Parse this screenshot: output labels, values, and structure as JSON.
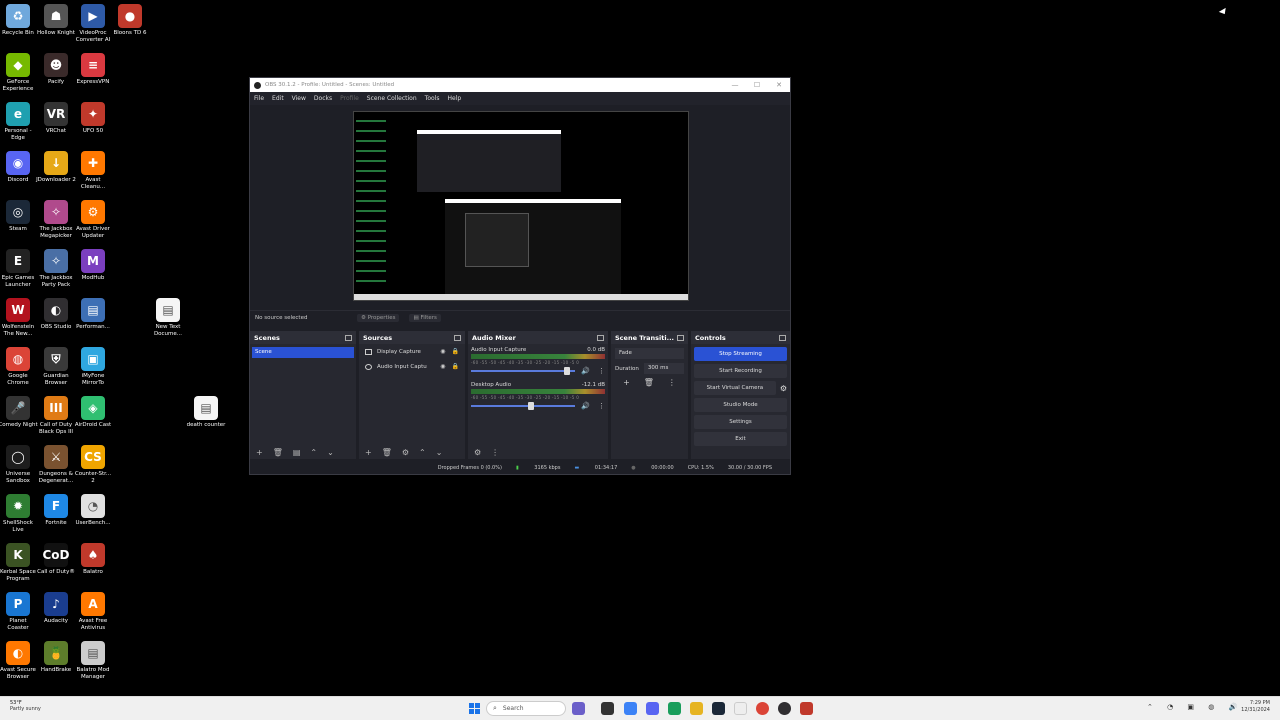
{
  "desktop": {
    "icons": [
      {
        "label": "Recycle Bin",
        "color": "#6fa8dc",
        "glyph": "♻"
      },
      {
        "label": "Hollow Knight",
        "color": "#555555",
        "glyph": "☗"
      },
      {
        "label": "VideoProc Converter AI",
        "color": "#2e5aa7",
        "glyph": "▶"
      },
      {
        "label": "Bloons TD 6",
        "color": "#c0392b",
        "glyph": "●"
      },
      {
        "label": "GeForce Experience",
        "color": "#76b900",
        "glyph": "◆"
      },
      {
        "label": "Pacify",
        "color": "#3a2a2a",
        "glyph": "☻"
      },
      {
        "label": "ExpressVPN",
        "color": "#da3940",
        "glyph": "≡"
      },
      {
        "label": "Personal - Edge",
        "color": "#1fa0b0",
        "glyph": "e"
      },
      {
        "label": "VRChat",
        "color": "#333333",
        "glyph": "VR"
      },
      {
        "label": "UFO 50",
        "color": "#c0392b",
        "glyph": "✦"
      },
      {
        "label": "Discord",
        "color": "#5865f2",
        "glyph": "◉"
      },
      {
        "label": "JDownloader 2",
        "color": "#e6a817",
        "glyph": "↓"
      },
      {
        "label": "Avast Cleanu...",
        "color": "#ff7800",
        "glyph": "✚"
      },
      {
        "label": "Steam",
        "color": "#1b2838",
        "glyph": "◎"
      },
      {
        "label": "The Jackbox Megapicker",
        "color": "#b04a8c",
        "glyph": "✧"
      },
      {
        "label": "Avast Driver Updater",
        "color": "#ff7800",
        "glyph": "⚙"
      },
      {
        "label": "Epic Games Launcher",
        "color": "#222222",
        "glyph": "E"
      },
      {
        "label": "The Jackbox Party Pack",
        "color": "#4a6fa5",
        "glyph": "✧"
      },
      {
        "label": "ModHub",
        "color": "#7b3fbf",
        "glyph": "M"
      },
      {
        "label": "Wolfenstein The New...",
        "color": "#b3121e",
        "glyph": "W"
      },
      {
        "label": "OBS Studio",
        "color": "#302e31",
        "glyph": "◐"
      },
      {
        "label": "Performan...",
        "color": "#3d6fb5",
        "glyph": "▤"
      },
      {
        "label": "Google Chrome",
        "color": "#db4437",
        "glyph": "◍"
      },
      {
        "label": "Guardian Browser",
        "color": "#3a3a3a",
        "glyph": "⛨"
      },
      {
        "label": "iMyFone MirrorTo",
        "color": "#2fa7e0",
        "glyph": "▣"
      },
      {
        "label": "Comedy Night",
        "color": "#333333",
        "glyph": "🎤"
      },
      {
        "label": "Call of Duty Black Ops III",
        "color": "#e07b15",
        "glyph": "III"
      },
      {
        "label": "AirDroid Cast",
        "color": "#2fbf71",
        "glyph": "◈"
      },
      {
        "label": "Universe Sandbox",
        "color": "#1d1d1d",
        "glyph": "◯"
      },
      {
        "label": "Dungeons & Degenerat...",
        "color": "#7a5230",
        "glyph": "⚔"
      },
      {
        "label": "Counter-Str... 2",
        "color": "#f0a500",
        "glyph": "CS"
      },
      {
        "label": "ShellShock Live",
        "color": "#2e7d32",
        "glyph": "✹"
      },
      {
        "label": "Fortnite",
        "color": "#1e88e5",
        "glyph": "F"
      },
      {
        "label": "UserBench...",
        "color": "#e0e0e0",
        "glyph": "◔"
      },
      {
        "label": "Kerbal Space Program",
        "color": "#3b5323",
        "glyph": "K"
      },
      {
        "label": "Call of Duty®",
        "color": "#111111",
        "glyph": "CoD"
      },
      {
        "label": "Balatro",
        "color": "#c0392b",
        "glyph": "♠"
      },
      {
        "label": "Planet Coaster",
        "color": "#1976d2",
        "glyph": "P"
      },
      {
        "label": "Audacity",
        "color": "#1a3d8f",
        "glyph": "♪"
      },
      {
        "label": "Avast Free Antivirus",
        "color": "#ff7800",
        "glyph": "A"
      },
      {
        "label": "Avast Secure Browser",
        "color": "#ff7800",
        "glyph": "◐"
      },
      {
        "label": "HandBrake",
        "color": "#5d7d2b",
        "glyph": "🍍"
      },
      {
        "label": "Balatro Mod Manager",
        "color": "#cccccc",
        "glyph": "▤"
      },
      {
        "label": "New Text Docume...",
        "color": "#f5f5f5",
        "glyph": "▤"
      },
      {
        "label": "death counter",
        "color": "#f5f5f5",
        "glyph": "▤"
      }
    ]
  },
  "obs": {
    "title": "OBS 30.1.2 - Profile: Untitled - Scenes: Untitled",
    "menu": [
      "File",
      "Edit",
      "View",
      "Docks",
      "Profile",
      "Scene Collection",
      "Tools",
      "Help"
    ],
    "no_source": "No source selected",
    "properties": "Properties",
    "filters": "Filters",
    "scenes": {
      "title": "Scenes",
      "items": [
        "Scene"
      ]
    },
    "sources": {
      "title": "Sources",
      "items": [
        "Display Capture",
        "Audio Input Captu"
      ]
    },
    "mixer": {
      "title": "Audio Mixer",
      "ticks": "-60 -55 -50 -45 -40 -35 -30 -25 -20 -15 -10 -5 0",
      "channels": [
        {
          "name": "Audio Input Capture",
          "db": "0.0 dB",
          "level": 0.92
        },
        {
          "name": "Desktop Audio",
          "db": "-12.1 dB",
          "level": 0.58
        }
      ]
    },
    "transitions": {
      "title": "Scene Transiti...",
      "type": "Fade",
      "duration_label": "Duration",
      "duration": "300 ms"
    },
    "controls": {
      "title": "Controls",
      "stop_streaming": "Stop Streaming",
      "start_recording": "Start Recording",
      "start_virtual_camera": "Start Virtual Camera",
      "studio_mode": "Studio Mode",
      "settings": "Settings",
      "exit": "Exit"
    },
    "status": {
      "dropped": "Dropped Frames 0 (0.0%)",
      "bitrate": "3165 kbps",
      "stream_time": "01:34:17",
      "rec_time": "00:00:00",
      "cpu": "CPU: 1.5%",
      "fps": "30.00 / 30.00 FPS"
    }
  },
  "taskbar": {
    "temp": "53°F",
    "weather": "Partly sunny",
    "search": "Search",
    "time": "7:29 PM",
    "date": "12/31/2024"
  }
}
